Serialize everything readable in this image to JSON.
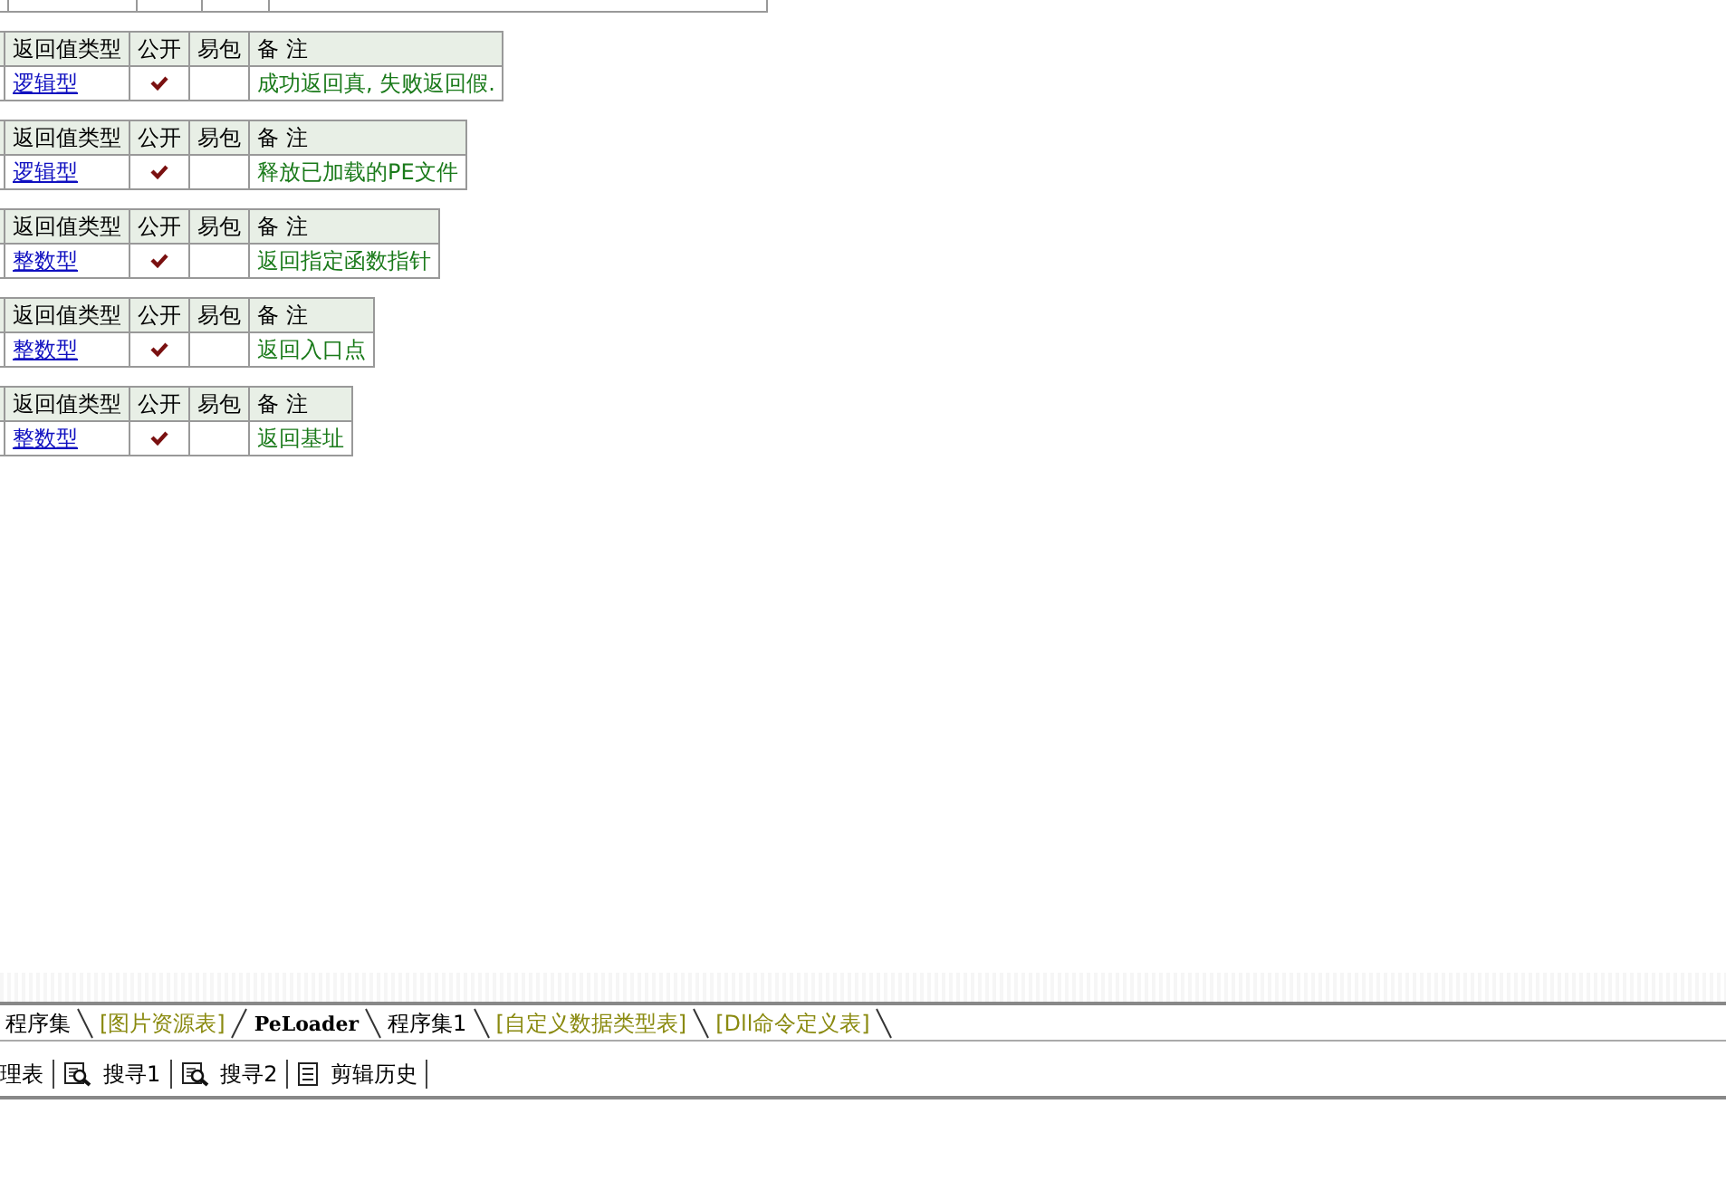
{
  "tables": [
    {
      "columns": [
        "返回值类型",
        "公开",
        "易包",
        "备 注"
      ],
      "return_type": "逻辑型",
      "public": true,
      "easy_pack": false,
      "note": "成功返回真, 失败返回假."
    },
    {
      "columns": [
        "返回值类型",
        "公开",
        "易包",
        "备 注"
      ],
      "return_type": "逻辑型",
      "public": true,
      "easy_pack": false,
      "note": "释放已加载的PE文件"
    },
    {
      "columns": [
        "返回值类型",
        "公开",
        "易包",
        "备 注"
      ],
      "return_type": "整数型",
      "public": true,
      "easy_pack": false,
      "note": "返回指定函数指针"
    },
    {
      "columns": [
        "返回值类型",
        "公开",
        "易包",
        "备 注"
      ],
      "return_type": "整数型",
      "public": true,
      "easy_pack": false,
      "note": "返回入口点"
    },
    {
      "columns": [
        "返回值类型",
        "公开",
        "易包",
        "备 注"
      ],
      "return_type": "整数型",
      "public": true,
      "easy_pack": false,
      "note": "返回基址"
    }
  ],
  "tabs": [
    {
      "label": "程序集",
      "kind": "code",
      "selected": false
    },
    {
      "label": "[图片资源表]",
      "kind": "resource",
      "selected": false
    },
    {
      "label": "PeLoader",
      "kind": "code",
      "selected": true
    },
    {
      "label": "程序集1",
      "kind": "code",
      "selected": false
    },
    {
      "label": "[自定义数据类型表]",
      "kind": "resource",
      "selected": false
    },
    {
      "label": "[Dll命令定义表]",
      "kind": "resource",
      "selected": false
    }
  ],
  "toolbar": [
    {
      "label": "理表",
      "kind": "plain"
    },
    {
      "label": "搜寻1",
      "kind": "search"
    },
    {
      "label": "搜寻2",
      "kind": "search"
    },
    {
      "label": "剪辑历史",
      "kind": "history"
    }
  ]
}
